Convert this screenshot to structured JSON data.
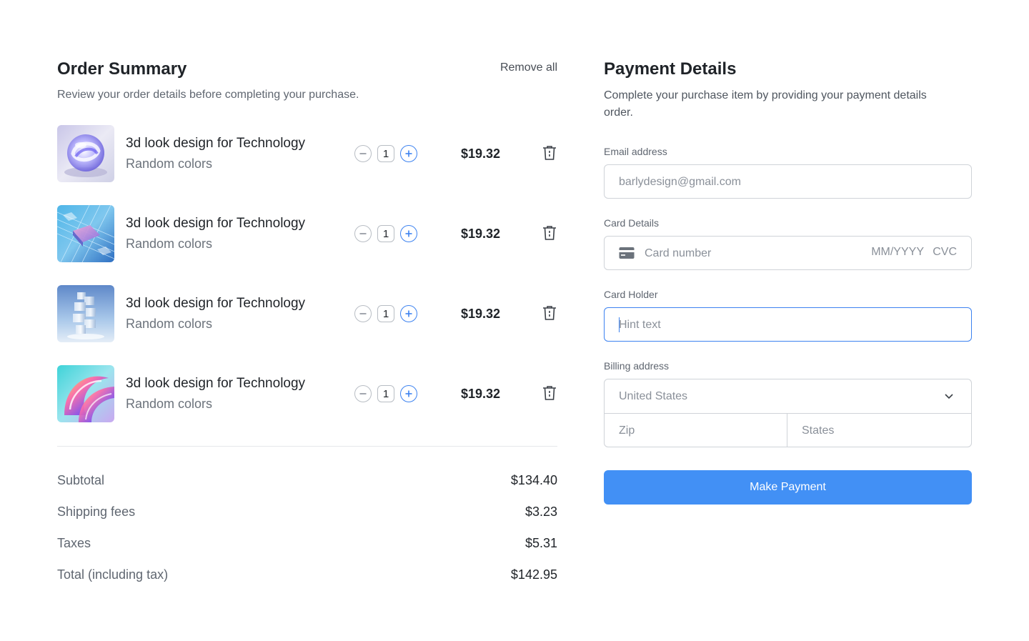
{
  "order_summary": {
    "title": "Order Summary",
    "remove_all_label": "Remove all",
    "subtitle": "Review your order details before completing your purchase.",
    "items": [
      {
        "name": "3d look design for Technology",
        "variant": "Random colors",
        "quantity": "1",
        "price": "$19.32",
        "thumbnail": "glass-ring-image"
      },
      {
        "name": "3d look design for Technology",
        "variant": "Random colors",
        "quantity": "1",
        "price": "$19.32",
        "thumbnail": "circuit-board-image"
      },
      {
        "name": "3d look design for Technology",
        "variant": "Random colors",
        "quantity": "1",
        "price": "$19.32",
        "thumbnail": "glass-tower-image"
      },
      {
        "name": "3d look design for Technology",
        "variant": "Random colors",
        "quantity": "1",
        "price": "$19.32",
        "thumbnail": "iridescent-swirl-image"
      }
    ],
    "totals": {
      "subtotal_label": "Subtotal",
      "subtotal_value": "$134.40",
      "shipping_label": "Shipping fees",
      "shipping_value": "$3.23",
      "taxes_label": "Taxes",
      "taxes_value": "$5.31",
      "total_label": "Total (including tax)",
      "total_value": "$142.95"
    }
  },
  "payment": {
    "title": "Payment Details",
    "subtitle_line1": "Complete your purchase item by providing your payment details",
    "subtitle_line2": "order.",
    "email": {
      "label": "Email address",
      "placeholder": "barlydesign@gmail.com"
    },
    "card": {
      "label": "Card Details",
      "number_placeholder": "Card number",
      "expiry_placeholder": "MM/YYYY",
      "cvc_placeholder": "CVC"
    },
    "holder": {
      "label": "Card Holder",
      "placeholder": "Hint text"
    },
    "billing": {
      "label": "Billing address",
      "country": "United States",
      "zip_placeholder": "Zip",
      "states_placeholder": "States"
    },
    "submit_label": "Make Payment"
  },
  "colors": {
    "accent": "#4290f5",
    "focus_border": "#3c82f0",
    "text_primary": "#1f2328",
    "text_secondary": "#5f6670"
  },
  "icons": [
    "minus-icon",
    "plus-icon",
    "trash-icon",
    "credit-card-icon",
    "chevron-down-icon"
  ]
}
